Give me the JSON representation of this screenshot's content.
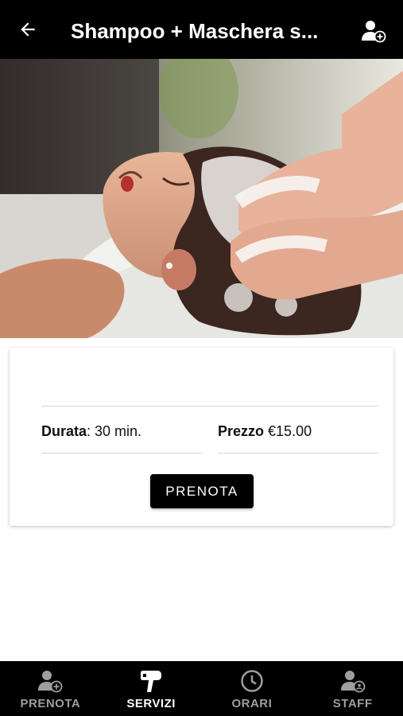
{
  "header": {
    "title": "Shampoo + Maschera s...",
    "back_icon": "arrow-left-icon",
    "action_icon": "user-add-icon"
  },
  "hero": {
    "image_subject": "woman receiving hair wash at salon basin"
  },
  "service": {
    "duration_label": "Durata",
    "duration_value": ": 30 min.",
    "price_label": "Prezzo",
    "price_value": " €15.00",
    "book_button": "PRENOTA"
  },
  "bottom_nav": {
    "items": [
      {
        "label": "PRENOTA",
        "icon": "user-add-icon",
        "active": false
      },
      {
        "label": "SERVIZI",
        "icon": "hair-dryer-icon",
        "active": true
      },
      {
        "label": "ORARI",
        "icon": "clock-icon",
        "active": false
      },
      {
        "label": "STAFF",
        "icon": "staff-icon",
        "active": false
      }
    ]
  },
  "colors": {
    "bar_background": "#000000",
    "active_nav": "#ffffff",
    "inactive_nav": "#9e9e9e",
    "button_background": "#000000"
  }
}
